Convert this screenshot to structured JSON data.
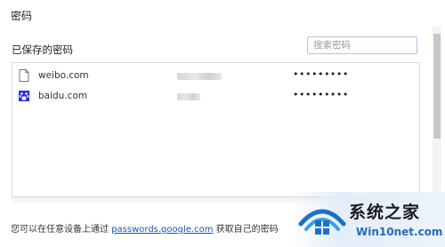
{
  "dialog": {
    "title": "密码",
    "section_title": "已保存的密码",
    "search": {
      "placeholder": "搜索密码",
      "value": ""
    }
  },
  "passwords": [
    {
      "site": "weibo.com",
      "password_mask": "•••••••••",
      "icon": "page-icon",
      "username_hidden": true
    },
    {
      "site": "baidu.com",
      "password_mask": "•••••••••",
      "icon": "baidu-paw-icon",
      "username_hidden": true
    }
  ],
  "footer": {
    "prefix": "您可以在任意设备上通过",
    "link": "passwords.google.com",
    "suffix": "获取自己的密码"
  },
  "watermark": {
    "text": "系统之家",
    "subtext": "Win10net.com"
  },
  "colors": {
    "link": "#1a56b0",
    "search_border": "#a9c6e8",
    "list_border": "#d9d9d9",
    "baidu_blue": "#2932e1"
  }
}
